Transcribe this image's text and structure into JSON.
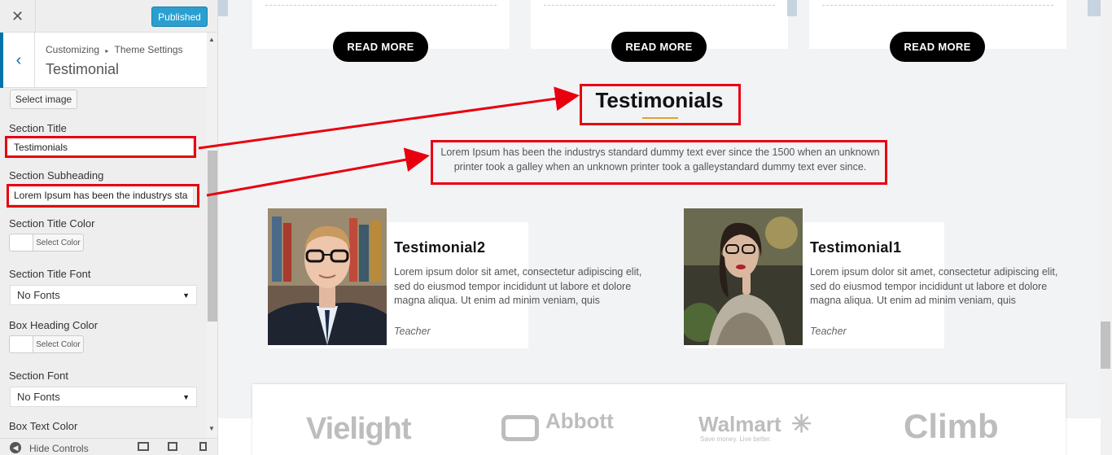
{
  "sidebar": {
    "close_glyph": "✕",
    "publish_label": "Published",
    "back_glyph": "‹",
    "breadcrumb_root": "Customizing",
    "breadcrumb_sep": "▸",
    "breadcrumb_section": "Theme Settings",
    "panel_title": "Testimonial",
    "select_image_label": "Select image",
    "section_title_label": "Section Title",
    "section_title_value": "Testimonials",
    "section_subheading_label": "Section Subheading",
    "section_subheading_value": "Lorem Ipsum has been the industrys sta",
    "section_title_color_label": "Section Title Color",
    "select_color_label": "Select Color",
    "section_title_font_label": "Section Title Font",
    "no_fonts": "No Fonts",
    "box_heading_color_label": "Box Heading Color",
    "section_font_label": "Section Font",
    "box_text_color_label": "Box Text Color",
    "hide_controls_label": "Hide Controls",
    "select_arrow": "▼"
  },
  "preview": {
    "read_more_label": "READ MORE",
    "section_title": "Testimonials",
    "section_subheading": "Lorem Ipsum has been the industrys standard dummy text ever since the 1500 when an unknown printer took a galley when an unknown printer took a galleystandard dummy text ever since.",
    "testimonials": [
      {
        "name": "Testimonial2",
        "text": "Lorem ipsum dolor sit amet, consectetur adipiscing elit, sed do eiusmod tempor incididunt ut labore et dolore magna aliqua. Ut enim ad minim veniam, quis",
        "role": "Teacher"
      },
      {
        "name": "Testimonial1",
        "text": "Lorem ipsum dolor sit amet, consectetur adipiscing elit, sed do eiusmod tempor incididunt ut labore et dolore magna aliqua. Ut enim ad minim veniam, quis",
        "role": "Teacher"
      }
    ],
    "logos": {
      "vielight": "Vielight",
      "abbott": "Abbott",
      "walmart": "Walmart",
      "walmart_tagline": "Save money. Live better.",
      "climb": "Climb"
    }
  },
  "colors": {
    "accent_blue": "#0073aa",
    "publish_button": "#2b9fcf",
    "annotation_red": "#e8000f",
    "title_underline": "#e8a02c"
  }
}
